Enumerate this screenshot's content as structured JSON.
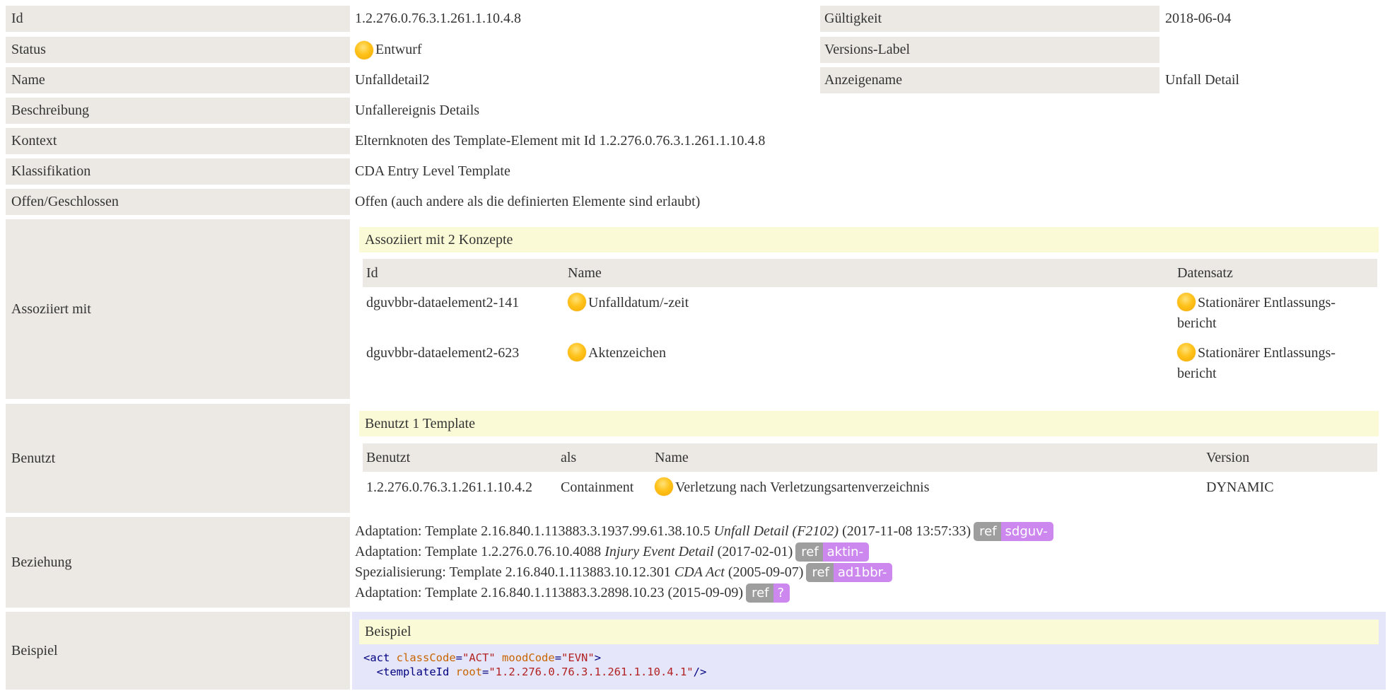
{
  "rows": {
    "id": {
      "label": "Id",
      "value": "1.2.276.0.76.3.1.261.1.10.4.8"
    },
    "gueltigkeit": {
      "label": "Gültigkeit",
      "value": "2018-06-04"
    },
    "status": {
      "label": "Status",
      "value": "Entwurf"
    },
    "versions_label": {
      "label": "Versions-Label",
      "value": ""
    },
    "name": {
      "label": "Name",
      "value": "Unfalldetail2"
    },
    "anzeigename": {
      "label": "Anzeigename",
      "value": "Unfall Detail"
    },
    "beschreibung": {
      "label": "Beschreibung",
      "value": "Unfallereignis Details"
    },
    "kontext": {
      "label": "Kontext",
      "value": "Elternknoten des Template-Element mit Id 1.2.276.0.76.3.1.261.1.10.4.8"
    },
    "klassifikation": {
      "label": "Klassifikation",
      "value": "CDA Entry Level Template"
    },
    "offen": {
      "label": "Offen/Geschlossen",
      "value": "Offen (auch andere als die definierten Elemente sind erlaubt)"
    }
  },
  "assoziiert": {
    "label": "Assoziiert mit",
    "heading": "Assoziiert mit 2 Konzepte",
    "columns": [
      "Id",
      "Name",
      "Datensatz"
    ],
    "items": [
      {
        "id": "dguvbbr-dataelement2-141",
        "name": "Unfalldatum/-zeit",
        "dataset_1": "Stationärer Entlassungs-",
        "dataset_2": "bericht"
      },
      {
        "id": "dguvbbr-dataelement2-623",
        "name": "Aktenzeichen",
        "dataset_1": "Stationärer Entlassungs-",
        "dataset_2": "bericht"
      }
    ]
  },
  "benutzt": {
    "label": "Benutzt",
    "heading": "Benutzt 1 Template",
    "columns": [
      "Benutzt",
      "als",
      "Name",
      "Version"
    ],
    "items": [
      {
        "id": "1.2.276.0.76.3.1.261.1.10.4.2",
        "als": "Containment",
        "name": "Verletzung nach Verletzungsartenverzeichnis",
        "version": "DYNAMIC"
      }
    ]
  },
  "beziehung": {
    "label": "Beziehung",
    "items": [
      {
        "prefix": "Adaptation: Template 2.16.840.1.113883.3.1937.99.61.38.10.5 ",
        "title": "Unfall Detail (F2102)",
        "suffix": " (2017-11-08 13:57:33)",
        "ref": "ref",
        "prefix_badge": "sdguv-"
      },
      {
        "prefix": "Adaptation: Template 1.2.276.0.76.10.4088 ",
        "title": "Injury Event Detail",
        "suffix": " (2017-02-01)",
        "ref": "ref",
        "prefix_badge": "aktin-"
      },
      {
        "prefix": "Spezialisierung: Template 2.16.840.1.113883.10.12.301 ",
        "title": "CDA Act",
        "suffix": " (2005-09-07)",
        "ref": "ref",
        "prefix_badge": "ad1bbr-"
      },
      {
        "prefix": "Adaptation: Template 2.16.840.1.113883.3.2898.10.23 (2015-09-09)",
        "title": "",
        "suffix": "",
        "ref": "ref",
        "prefix_badge": "?"
      }
    ]
  },
  "beispiel": {
    "label": "Beispiel",
    "heading": "Beispiel",
    "code": {
      "line1_tag": "<act",
      "line1_attr1": "classCode",
      "line1_eq1": "=",
      "line1_val1": "\"ACT\"",
      "line1_attr2": "moodCode",
      "line1_eq2": "=",
      "line1_val2": "\"EVN\"",
      "line1_end": ">",
      "line2_tag": "<templateId",
      "line2_attr": "root",
      "line2_eq": "=",
      "line2_val": "\"1.2.276.0.76.3.1.261.1.10.4.1\"",
      "line2_end": "/>"
    }
  }
}
